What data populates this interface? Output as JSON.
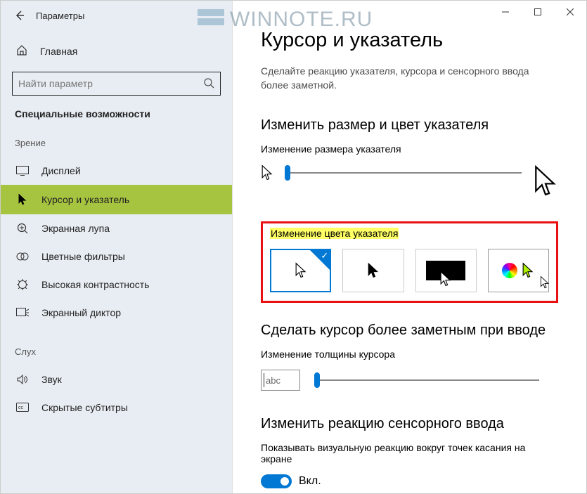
{
  "window": {
    "app_title": "Параметры"
  },
  "watermark": {
    "text": "WINNOTE.RU"
  },
  "sidebar": {
    "home_label": "Главная",
    "search_placeholder": "Найти параметр",
    "section_label": "Специальные возможности",
    "groups": {
      "vision": "Зрение",
      "hearing": "Слух"
    },
    "items": [
      {
        "label": "Дисплей"
      },
      {
        "label": "Курсор и указатель"
      },
      {
        "label": "Экранная лупа"
      },
      {
        "label": "Цветные фильтры"
      },
      {
        "label": "Высокая контрастность"
      },
      {
        "label": "Экранный диктор"
      }
    ],
    "hearing_items": [
      {
        "label": "Звук"
      },
      {
        "label": "Скрытые субтитры"
      }
    ]
  },
  "main": {
    "heading": "Курсор и указатель",
    "subtitle": "Сделайте реакцию указателя, курсора и сенсорного ввода более заметной.",
    "section_pointer": "Изменить размер и цвет указателя",
    "pointer_size_label": "Изменение размера указателя",
    "pointer_size_value": 1,
    "pointer_color_label": "Изменение цвета указателя",
    "pointer_color_options": [
      {
        "id": "white",
        "selected": true
      },
      {
        "id": "black",
        "selected": false
      },
      {
        "id": "inverted",
        "selected": false
      },
      {
        "id": "custom",
        "selected": false
      }
    ],
    "section_cursor": "Сделать курсор более заметным при вводе",
    "cursor_thickness_label": "Изменение толщины курсора",
    "cursor_sample_text": "abc",
    "cursor_thickness_value": 1,
    "section_touch": "Изменить реакцию сенсорного ввода",
    "touch_feedback_label": "Показывать визуальную реакцию вокруг точек касания на экране",
    "touch_feedback_toggle": {
      "on": true,
      "on_label": "Вкл."
    }
  }
}
